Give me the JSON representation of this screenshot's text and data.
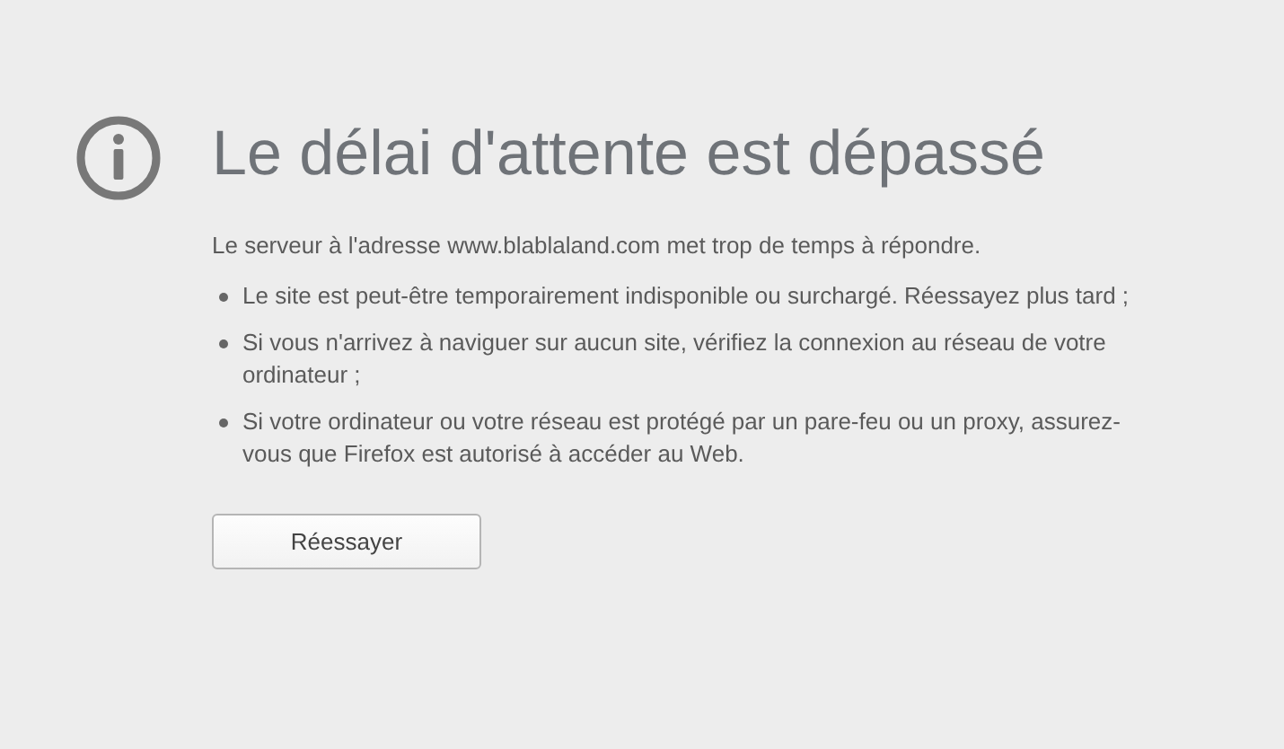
{
  "title": "Le délai d'attente est dépassé",
  "message": "Le serveur à l'adresse www.blablaland.com met trop de temps à répondre.",
  "bullets": [
    "Le site est peut-être temporairement indisponible ou surchargé. Réessayez plus tard ;",
    "Si vous n'arrivez à naviguer sur aucun site, vérifiez la connexion au réseau de votre ordinateur ;",
    "Si votre ordinateur ou votre réseau est protégé par un pare-feu ou un proxy, assurez-vous que Firefox est autorisé à accéder au Web."
  ],
  "button": "Réessayer"
}
